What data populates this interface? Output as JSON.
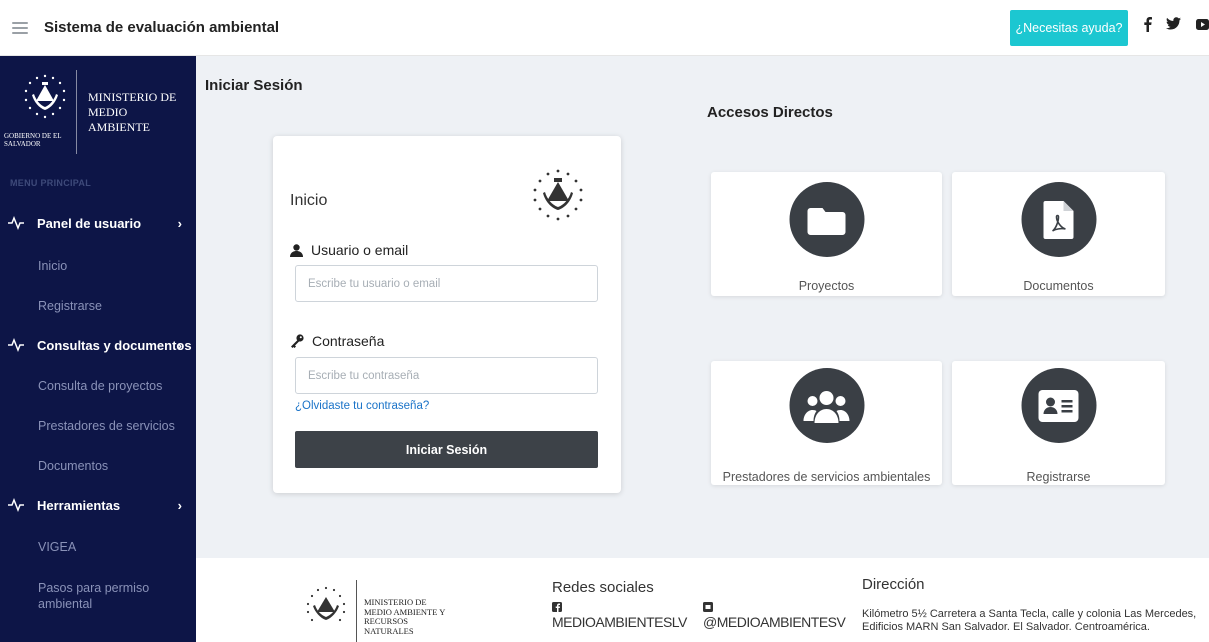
{
  "header": {
    "app_title": "Sistema de evaluación ambiental",
    "help_label": "¿Necesitas ayuda?",
    "social_icons": [
      "facebook-icon",
      "twitter-icon",
      "youtube-icon"
    ],
    "accent_color": "#1cc7d1"
  },
  "sidebar": {
    "brand_ministry": "MINISTERIO DE MEDIO AMBIENTE",
    "brand_gov": "GOBIERNO DE EL SALVADOR",
    "menu_heading": "MENU PRINCIPAL",
    "background_color": "#0d1547",
    "sections": [
      {
        "label": "Panel de usuario",
        "items": [
          "Inicio",
          "Registrarse"
        ]
      },
      {
        "label": "Consultas y documentos",
        "items": [
          "Consulta de proyectos",
          "Prestadores de servicios",
          "Documentos"
        ]
      },
      {
        "label": "Herramientas",
        "items": [
          "VIGEA",
          "Pasos para permiso ambiental"
        ]
      }
    ]
  },
  "main": {
    "page_title": "Iniciar Sesión",
    "login": {
      "title": "Inicio",
      "username_label": "Usuario o email",
      "username_placeholder": "Escribe tu usuario o email",
      "password_label": "Contraseña",
      "password_placeholder": "Escribe tu contraseña",
      "forgot_link": "¿Olvidaste tu contraseña?",
      "submit_label": "Iniciar Sesión"
    },
    "shortcuts_title": "Accesos Directos",
    "shortcuts": [
      {
        "label": "Proyectos",
        "icon": "folder-icon"
      },
      {
        "label": "Documentos",
        "icon": "pdf-document-icon"
      },
      {
        "label": "Prestadores de servicios ambientales",
        "icon": "users-group-icon"
      },
      {
        "label": "Registrarse",
        "icon": "id-card-icon"
      }
    ]
  },
  "footer": {
    "ministry": "MINISTERIO DE MEDIO AMBIENTE Y RECURSOS NATURALES",
    "social_heading": "Redes sociales",
    "facebook_handle": "MEDIOAMBIENTESLV",
    "twitter_handle": "@MEDIOAMBIENTESV",
    "address_heading": "Dirección",
    "address": "Kilómetro 5½ Carretera a Santa Tecla, calle y colonia Las Mercedes, Edificios MARN San Salvador. El Salvador. Centroamérica."
  }
}
